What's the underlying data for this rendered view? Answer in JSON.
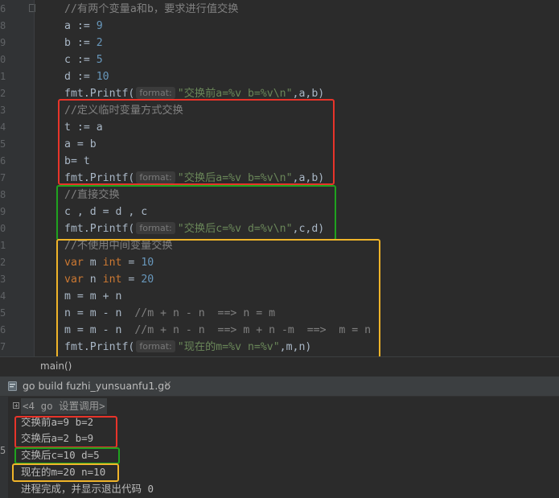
{
  "editor": {
    "lines": [
      {
        "num": "6",
        "comment": "//有两个变量a和b，要求进行值交换"
      },
      {
        "num": "8",
        "var": "a",
        "op": " := ",
        "val": "9"
      },
      {
        "num": "9",
        "var": "b",
        "op": " := ",
        "val": "2"
      },
      {
        "num": "0",
        "var": "c",
        "op": " := ",
        "val": "5"
      },
      {
        "num": "1",
        "var": "d",
        "op": " := ",
        "val": "10"
      },
      {
        "num": "2",
        "fn": "fmt.Printf(",
        "hint": "format:",
        "str": "\"交换前a=%v b=%v\\n\"",
        "rest": ",a,b)"
      },
      {
        "num": "3",
        "comment": "//定义临时变量方式交换"
      },
      {
        "num": "4",
        "plain": "t := a"
      },
      {
        "num": "5",
        "plain": "a = b"
      },
      {
        "num": "6",
        "plain": "b= t"
      },
      {
        "num": "7",
        "fn": "fmt.Printf(",
        "hint": "format:",
        "str": "\"交换后a=%v b=%v\\n\"",
        "rest": ",a,b)"
      },
      {
        "num": "8",
        "comment": "//直接交换"
      },
      {
        "num": "9",
        "plain": "c , d = d , c"
      },
      {
        "num": "0",
        "fn": "fmt.Printf(",
        "hint": "format:",
        "str": "\"交换后c=%v d=%v\\n\"",
        "rest": ",c,d)"
      },
      {
        "num": "1",
        "comment": "//不使用中间变量交换"
      },
      {
        "num": "2",
        "kw": "var",
        "name": " m ",
        "type": "int",
        "eq": " = ",
        "val": "10"
      },
      {
        "num": "3",
        "kw": "var",
        "name": " n ",
        "type": "int",
        "eq": " = ",
        "val": "20"
      },
      {
        "num": "4",
        "plain": "m = m + n"
      },
      {
        "num": "5",
        "plain": "n = m - n  ",
        "comment": "//m + n - n  ==> n = m"
      },
      {
        "num": "6",
        "plain": "m = m - n  ",
        "comment": "//m + n - n  ==> m + n -m  ==>  m = n"
      },
      {
        "num": "7",
        "fn": "fmt.Printf(",
        "hint": "format:",
        "str": "\"现在的m=%v n=%v\"",
        "rest": ",m,n)"
      }
    ]
  },
  "breadcrumb": {
    "label": "main()"
  },
  "run": {
    "title": "go build fuzhi_yunsuanfu1.go",
    "close_glyph": "×",
    "group": "<4 go 设置调用>",
    "output": [
      "交换前a=9 b=2",
      "交换后a=2 b=9",
      "交换后c=10 d=5",
      "现在的m=20 n=10",
      "进程完成，并显示退出代码 0"
    ],
    "side_marker": "5"
  },
  "colors": {
    "red": "#e8342a",
    "green": "#1fa31f",
    "yellow": "#f0b429"
  }
}
